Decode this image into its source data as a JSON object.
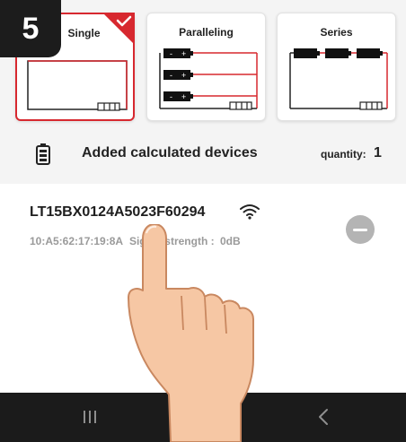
{
  "step_number": "5",
  "modes": [
    {
      "label": "Single",
      "selected": true
    },
    {
      "label": "Paralleling",
      "selected": false
    },
    {
      "label": "Series",
      "selected": false
    }
  ],
  "added": {
    "label": "Added calculated devices",
    "quantity_label": "quantity:",
    "quantity_value": "1"
  },
  "device": {
    "name": "LT15BX0124A5023F60294",
    "mac": "10:A5:62:17:19:8A",
    "signal_label": "Signal strength :",
    "signal_value": "0dB"
  },
  "icons": {
    "battery": "battery-icon",
    "wifi": "wifi-icon",
    "remove": "minus-circle-icon",
    "check": "checkmark-icon",
    "nav_recents": "recents-icon",
    "nav_home": "home-icon",
    "nav_back": "back-icon"
  },
  "colors": {
    "accent": "#d7282f",
    "background_top": "#f4f4f4",
    "nav_bar": "#1b1b1b",
    "secondary_text": "#9a9a9a",
    "remove_button": "#b4b4b4"
  }
}
